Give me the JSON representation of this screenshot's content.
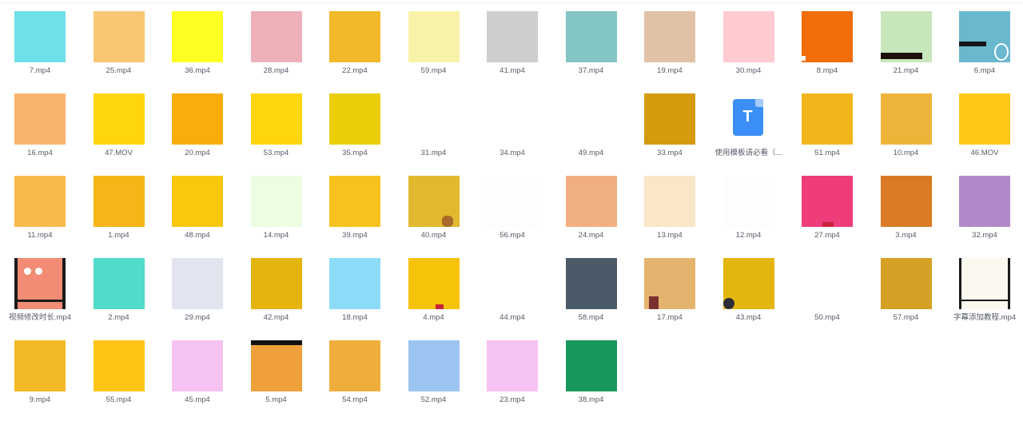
{
  "files": [
    {
      "name": "7.mp4",
      "thumb_color": "#6ee0e8",
      "icon": "video-thumbnail"
    },
    {
      "name": "25.mp4",
      "thumb_color": "#f8c774",
      "icon": "video-thumbnail"
    },
    {
      "name": "36.mp4",
      "thumb_color": "#fffe22",
      "icon": "video-thumbnail"
    },
    {
      "name": "28.mp4",
      "thumb_color": "#eeb0b8",
      "icon": "video-thumbnail"
    },
    {
      "name": "22.mp4",
      "thumb_color": "#f2b92b",
      "icon": "video-thumbnail"
    },
    {
      "name": "59.mp4",
      "thumb_color": "#f8f2a8",
      "icon": "video-thumbnail"
    },
    {
      "name": "41.mp4",
      "thumb_color": "#cfcdd0",
      "icon": "video-thumbnail"
    },
    {
      "name": "37.mp4",
      "thumb_color": "#83c5c4",
      "icon": "video-thumbnail"
    },
    {
      "name": "19.mp4",
      "thumb_color": "#e1c2a6",
      "icon": "video-thumbnail"
    },
    {
      "name": "30.mp4",
      "thumb_color": "#fdcbd0",
      "icon": "video-thumbnail"
    },
    {
      "name": "8.mp4",
      "thumb_color": "#f06d0a",
      "icon": "video-thumbnail"
    },
    {
      "name": "21.mp4",
      "thumb_color": "#c8e6bb",
      "icon": "video-thumbnail"
    },
    {
      "name": "6.mp4",
      "thumb_color": "#6ab8ce",
      "icon": "video-thumbnail"
    },
    {
      "name": "16.mp4",
      "thumb_color": "#f9b36c",
      "icon": "video-thumbnail"
    },
    {
      "name": "47.MOV",
      "thumb_color": "#ffd50c",
      "icon": "video-thumbnail"
    },
    {
      "name": "20.mp4",
      "thumb_color": "#f7ae0b",
      "icon": "video-thumbnail"
    },
    {
      "name": "53.mp4",
      "thumb_color": "#ffd50c",
      "icon": "video-thumbnail"
    },
    {
      "name": "35.mp4",
      "thumb_color": "#e8cf08",
      "icon": "video-thumbnail"
    },
    {
      "name": "31.mp4",
      "thumb_color": "#ffffff",
      "icon": "video-thumbnail"
    },
    {
      "name": "34.mp4",
      "thumb_color": "#ffffff",
      "icon": "video-thumbnail"
    },
    {
      "name": "49.mp4",
      "thumb_color": "#ffffff",
      "icon": "video-thumbnail"
    },
    {
      "name": "33.mp4",
      "thumb_color": "#d59a0d",
      "icon": "video-thumbnail"
    },
    {
      "name": "使用模板请必看（...",
      "thumb_color": "#ffffff",
      "icon": "document-icon",
      "icon_letter": "T"
    },
    {
      "name": "51.mp4",
      "thumb_color": "#f2b51c",
      "icon": "video-thumbnail"
    },
    {
      "name": "10.mp4",
      "thumb_color": "#eeb43a",
      "icon": "video-thumbnail"
    },
    {
      "name": "46.MOV",
      "thumb_color": "#ffc716",
      "icon": "video-thumbnail"
    },
    {
      "name": "11.mp4",
      "thumb_color": "#f9b94b",
      "icon": "video-thumbnail"
    },
    {
      "name": "1.mp4",
      "thumb_color": "#f5b717",
      "icon": "video-thumbnail"
    },
    {
      "name": "48.mp4",
      "thumb_color": "#f8c70e",
      "icon": "video-thumbnail"
    },
    {
      "name": "14.mp4",
      "thumb_color": "#ecfde2",
      "icon": "video-thumbnail"
    },
    {
      "name": "39.mp4",
      "thumb_color": "#f8c21e",
      "icon": "video-thumbnail"
    },
    {
      "name": "40.mp4",
      "thumb_color": "#e2b92e",
      "icon": "video-thumbnail"
    },
    {
      "name": "56.mp4",
      "thumb_color": "#fdfdfd",
      "icon": "video-thumbnail"
    },
    {
      "name": "24.mp4",
      "thumb_color": "#f2ae83",
      "icon": "video-thumbnail"
    },
    {
      "name": "13.mp4",
      "thumb_color": "#f9e7c7",
      "icon": "video-thumbnail"
    },
    {
      "name": "12.mp4",
      "thumb_color": "#fdfdfd",
      "icon": "video-thumbnail"
    },
    {
      "name": "27.mp4",
      "thumb_color": "#ee3d7a",
      "icon": "video-thumbnail"
    },
    {
      "name": "3.mp4",
      "thumb_color": "#da7a24",
      "icon": "video-thumbnail"
    },
    {
      "name": "32.mp4",
      "thumb_color": "#b089c9",
      "icon": "video-thumbnail"
    },
    {
      "name": "视频修改时长.mp4",
      "thumb_color": "#f28c74",
      "icon": "video-thumbnail"
    },
    {
      "name": "2.mp4",
      "thumb_color": "#50dcc8",
      "icon": "video-thumbnail"
    },
    {
      "name": "29.mp4",
      "thumb_color": "#e2e4f0",
      "icon": "video-thumbnail"
    },
    {
      "name": "42.mp4",
      "thumb_color": "#e4b30c",
      "icon": "video-thumbnail"
    },
    {
      "name": "18.mp4",
      "thumb_color": "#8cdcf8",
      "icon": "video-thumbnail"
    },
    {
      "name": "4.mp4",
      "thumb_color": "#f6c20a",
      "icon": "video-thumbnail"
    },
    {
      "name": "44.mp4",
      "thumb_color": "#ffffff",
      "icon": "video-thumbnail"
    },
    {
      "name": "58.mp4",
      "thumb_color": "#4b5a68",
      "icon": "video-thumbnail"
    },
    {
      "name": "17.mp4",
      "thumb_color": "#e4b46e",
      "icon": "video-thumbnail"
    },
    {
      "name": "43.mp4",
      "thumb_color": "#e4b50c",
      "icon": "video-thumbnail"
    },
    {
      "name": "50.mp4",
      "thumb_color": "#ffffff",
      "icon": "video-thumbnail"
    },
    {
      "name": "57.mp4",
      "thumb_color": "#d6a024",
      "icon": "video-thumbnail"
    },
    {
      "name": "字幕添加教程.mp4",
      "thumb_color": "#fbf8f0",
      "icon": "video-thumbnail"
    },
    {
      "name": "9.mp4",
      "thumb_color": "#f4b926",
      "icon": "video-thumbnail"
    },
    {
      "name": "55.mp4",
      "thumb_color": "#ffc516",
      "icon": "video-thumbnail"
    },
    {
      "name": "45.mp4",
      "thumb_color": "#f6c2f2",
      "icon": "video-thumbnail"
    },
    {
      "name": "5.mp4",
      "thumb_color": "#f0a03a",
      "icon": "video-thumbnail"
    },
    {
      "name": "54.mp4",
      "thumb_color": "#efae3c",
      "icon": "video-thumbnail"
    },
    {
      "name": "52.mp4",
      "thumb_color": "#9cc4f0",
      "icon": "video-thumbnail"
    },
    {
      "name": "23.mp4",
      "thumb_color": "#f6c2f2",
      "icon": "video-thumbnail"
    },
    {
      "name": "38.mp4",
      "thumb_color": "#18985c",
      "icon": "video-thumbnail"
    }
  ]
}
